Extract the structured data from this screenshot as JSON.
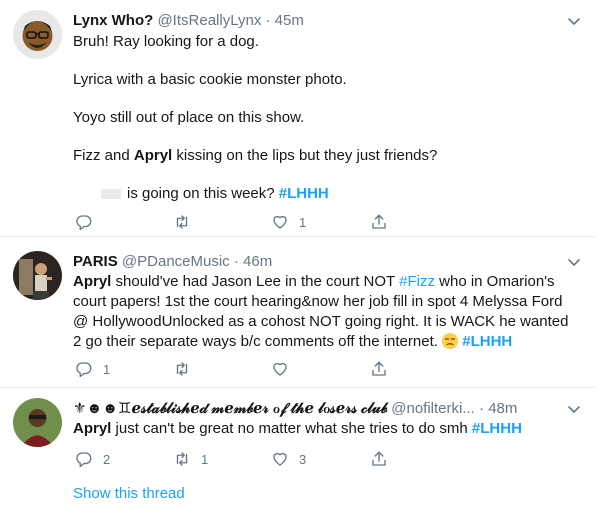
{
  "tweets": [
    {
      "name": "Lynx Who?",
      "handle": "@ItsReallyLynx",
      "dot": "·",
      "time": "45m",
      "lines": [
        "Bruh! Ray looking for a dog.",
        "Lyrica with a basic cookie monster photo.",
        "Yoyo still out of place on this show.",
        "Fizz and",
        "Apryl",
        "kissing on the lips but they just friends?",
        "is going on this week?",
        "#LHHH"
      ],
      "like_count": "1"
    },
    {
      "name": "PARIS",
      "handle": "@PDanceMusic",
      "dot": "·",
      "time": "46m",
      "mention": "Apryl",
      "text1": "should've had Jason Lee in the court NOT",
      "hashtag_fizz": "#Fizz",
      "text2": "who in Omarion's court papers! 1st the court hearing&now her job fill in spot 4 Melyssa Ford @ HollywoodUnlocked as a cohost NOT going right. It is WACK he wanted 2 go their separate ways b/c comments off the internet.",
      "hashtag": "#LHHH",
      "reply_count": "1",
      "emoji_icon": "unamused-face-emoji"
    },
    {
      "name": "⚜☻☻♊ℯ𝓈𝓉𝒶𝒷𝓁𝒾𝓈𝒽ℯ𝒹 𝓂ℯ𝓂𝒷ℯ𝓇 ℴ𝒻 𝓉𝒽ℯ 𝓁ℴ𝓈ℯ𝓇𝓈 𝒸𝓁𝓊𝒷",
      "handle": "@nofilterki...",
      "dot": "·",
      "time": "48m",
      "mention": "Apryl",
      "text": "just can't be great no matter what she tries to do smh",
      "hashtag": "#LHHH",
      "reply_count": "2",
      "retweet_count": "1",
      "like_count": "3"
    }
  ],
  "show_thread": "Show this thread",
  "colors": {
    "link": "#1da1f2",
    "muted": "#657786",
    "divider": "#e6ecf0"
  }
}
